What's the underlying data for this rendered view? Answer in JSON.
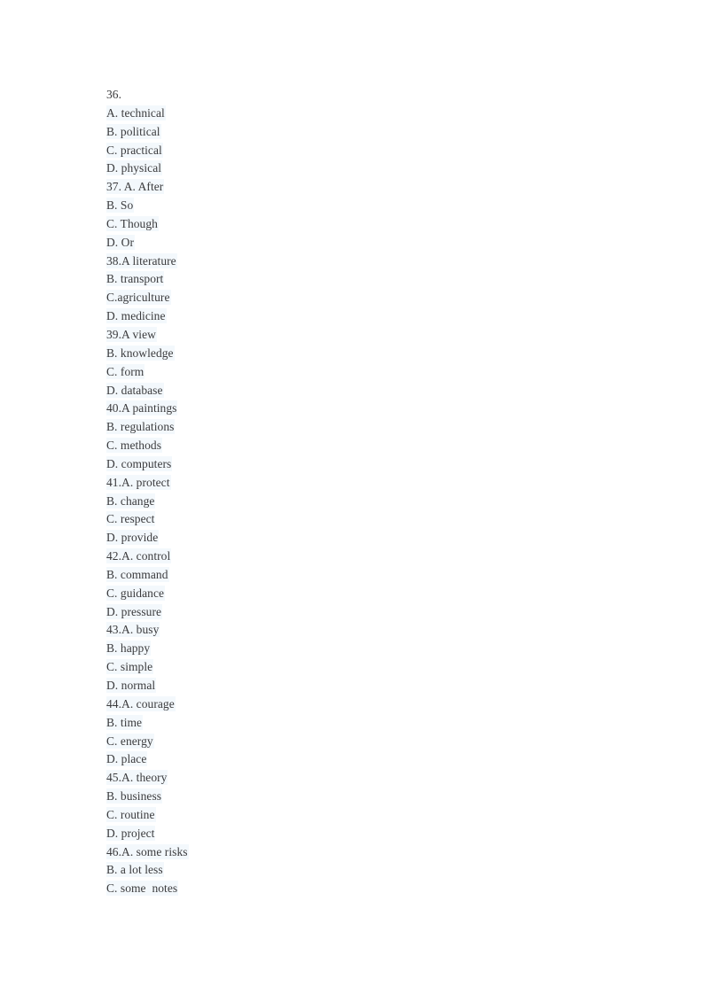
{
  "document": {
    "page_background": "#ffffff",
    "text_color": "#3b3b3d",
    "highlight_color": "#f3f8fc",
    "lines": [
      {
        "text": "36.",
        "highlight": false
      },
      {
        "text": "A. technical",
        "highlight": true
      },
      {
        "text": "B. political",
        "highlight": true
      },
      {
        "text": "C. practical",
        "highlight": true
      },
      {
        "text": "D. physical",
        "highlight": true
      },
      {
        "text": "37. A. After",
        "highlight": true
      },
      {
        "text": "B. So",
        "highlight": true
      },
      {
        "text": "C. Though",
        "highlight": true
      },
      {
        "text": "D. Or",
        "highlight": true
      },
      {
        "text": "38.A literature",
        "highlight": true
      },
      {
        "text": "B. transport",
        "highlight": true
      },
      {
        "text": "C.agriculture",
        "highlight": true
      },
      {
        "text": "D. medicine",
        "highlight": true
      },
      {
        "text": "39.A view",
        "highlight": true
      },
      {
        "text": "B. knowledge",
        "highlight": true
      },
      {
        "text": "C. form",
        "highlight": true
      },
      {
        "text": "D. database",
        "highlight": true
      },
      {
        "text": "40.A paintings",
        "highlight": true
      },
      {
        "text": "B. regulations",
        "highlight": true
      },
      {
        "text": "C. methods",
        "highlight": true
      },
      {
        "text": "D. computers",
        "highlight": true
      },
      {
        "text": "41.A. protect",
        "highlight": true
      },
      {
        "text": "B. change",
        "highlight": true
      },
      {
        "text": "C. respect",
        "highlight": true
      },
      {
        "text": "D. provide",
        "highlight": true
      },
      {
        "text": "42.A. control",
        "highlight": true
      },
      {
        "text": "B. command",
        "highlight": true
      },
      {
        "text": "C. guidance",
        "highlight": true
      },
      {
        "text": "D. pressure",
        "highlight": true
      },
      {
        "text": "43.A. busy",
        "highlight": true
      },
      {
        "text": "B. happy",
        "highlight": true
      },
      {
        "text": "C. simple",
        "highlight": true
      },
      {
        "text": "D. normal",
        "highlight": true
      },
      {
        "text": "44.A. courage",
        "highlight": true
      },
      {
        "text": "B. time",
        "highlight": true
      },
      {
        "text": "C. energy",
        "highlight": true
      },
      {
        "text": "D. place",
        "highlight": true
      },
      {
        "text": "45.A. theory",
        "highlight": true
      },
      {
        "text": "B. business",
        "highlight": true
      },
      {
        "text": "C. routine",
        "highlight": true
      },
      {
        "text": "D. project",
        "highlight": true
      },
      {
        "text": "46.A. some risks",
        "highlight": true
      },
      {
        "text": "B. a lot less",
        "highlight": true
      },
      {
        "text": "C. some  notes",
        "highlight": true
      }
    ]
  }
}
